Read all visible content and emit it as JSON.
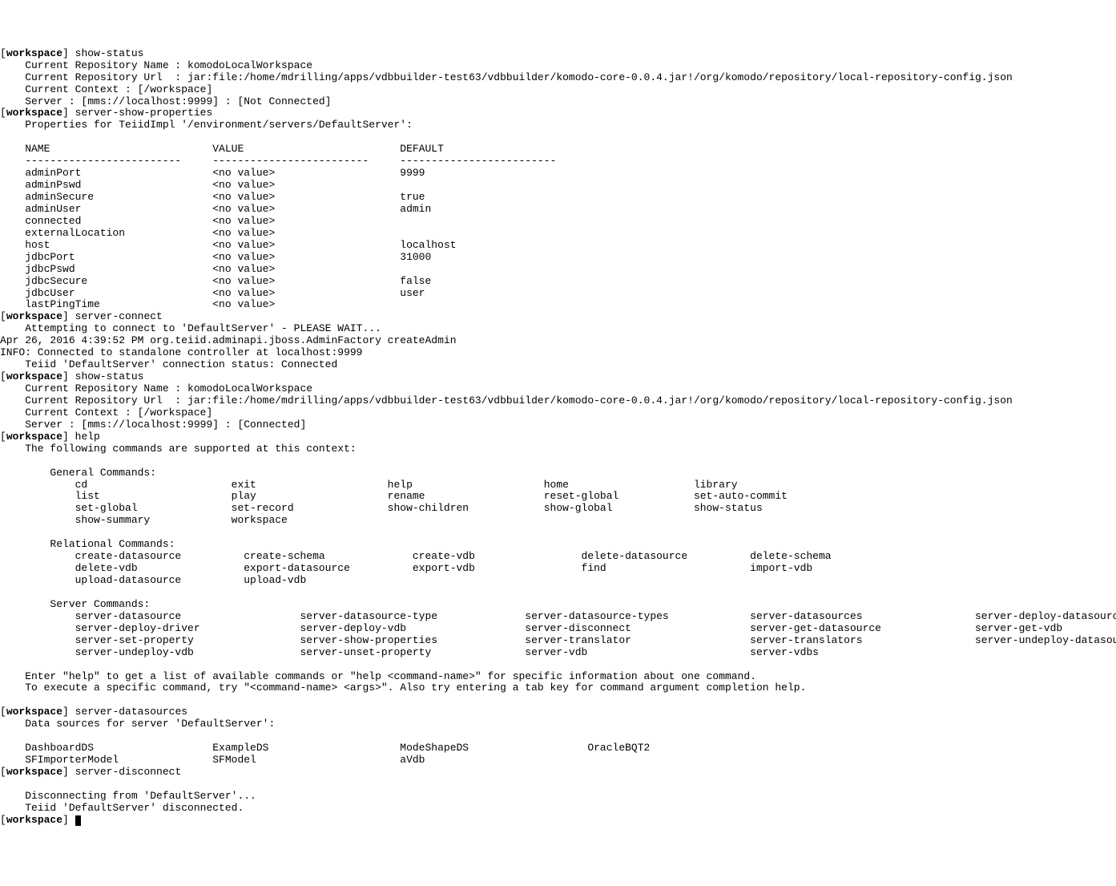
{
  "prompt_bold": "workspace",
  "commands": {
    "c1": "show-status",
    "c2": "server-show-properties",
    "c3": "server-connect",
    "c4": "show-status",
    "c5": "help",
    "c6": "server-datasources",
    "c7": "server-disconnect",
    "c8": ""
  },
  "status1": {
    "repo_name": "    Current Repository Name : komodoLocalWorkspace",
    "repo_url": "    Current Repository Url  : jar:file:/home/mdrilling/apps/vdbbuilder-test63/vdbbuilder/komodo-core-0.0.4.jar!/org/komodo/repository/local-repository-config.json",
    "context": "    Current Context : [/workspace]",
    "server": "    Server : [mms://localhost:9999] : [Not Connected]"
  },
  "server_props": {
    "header": "    Properties for TeiidImpl '/environment/servers/DefaultServer':",
    "blank": "",
    "cols": "    NAME                          VALUE                         DEFAULT",
    "sep": "    -------------------------     -------------------------     -------------------------",
    "r1": "    adminPort                     <no value>                    9999",
    "r2": "    adminPswd                     <no value>",
    "r3": "    adminSecure                   <no value>                    true",
    "r4": "    adminUser                     <no value>                    admin",
    "r5": "    connected                     <no value>",
    "r6": "    externalLocation              <no value>",
    "r7": "    host                          <no value>                    localhost",
    "r8": "    jdbcPort                      <no value>                    31000",
    "r9": "    jdbcPswd                      <no value>",
    "r10": "    jdbcSecure                    <no value>                    false",
    "r11": "    jdbcUser                      <no value>                    user",
    "r12": "    lastPingTime                  <no value>"
  },
  "connect": {
    "l1": "    Attempting to connect to 'DefaultServer' - PLEASE WAIT...",
    "l2": "Apr 26, 2016 4:39:52 PM org.teiid.adminapi.jboss.AdminFactory createAdmin",
    "l3": "INFO: Connected to standalone controller at localhost:9999",
    "l4": "    Teiid 'DefaultServer' connection status: Connected"
  },
  "status2": {
    "repo_name": "    Current Repository Name : komodoLocalWorkspace",
    "repo_url": "    Current Repository Url  : jar:file:/home/mdrilling/apps/vdbbuilder-test63/vdbbuilder/komodo-core-0.0.4.jar!/org/komodo/repository/local-repository-config.json",
    "context": "    Current Context : [/workspace]",
    "server": "    Server : [mms://localhost:9999] : [Connected]"
  },
  "help": {
    "intro": "    The following commands are supported at this context:",
    "blank": "",
    "gen_title": "        General Commands:",
    "gen_r1": "            cd                       exit                     help                     home                    library",
    "gen_r2": "            list                     play                     rename                   reset-global            set-auto-commit",
    "gen_r3": "            set-global               set-record               show-children            show-global             show-status",
    "gen_r4": "            show-summary             workspace",
    "rel_title": "        Relational Commands:",
    "rel_r1": "            create-datasource          create-schema              create-vdb                 delete-datasource          delete-schema",
    "rel_r2": "            delete-vdb                 export-datasource          export-vdb                 find                       import-vdb",
    "rel_r3": "            upload-datasource          upload-vdb",
    "srv_title": "        Server Commands:",
    "srv_r1": "            server-datasource                   server-datasource-type              server-datasource-types             server-datasources                  server-deploy-datasource",
    "srv_r2": "            server-deploy-driver                server-deploy-vdb                   server-disconnect                   server-get-datasource               server-get-vdb",
    "srv_r3": "            server-set-property                 server-show-properties              server-translator                   server-translators                  server-undeploy-datasource",
    "srv_r4": "            server-undeploy-vdb                 server-unset-property               server-vdb                          server-vdbs",
    "foot1": "    Enter \"help\" to get a list of available commands or \"help <command-name>\" for specific information about one command.",
    "foot2": "    To execute a specific command, try \"<command-name> <args>\". Also try entering a tab key for command argument completion help."
  },
  "datasources": {
    "header": "    Data sources for server 'DefaultServer':",
    "blank": "",
    "r1": "    DashboardDS                   ExampleDS                     ModeShapeDS                   OracleBQT2",
    "r2": "    SFImporterModel               SFModel                       aVdb"
  },
  "disconnect": {
    "blank": "",
    "l1": "    Disconnecting from 'DefaultServer'...",
    "l2": "    Teiid 'DefaultServer' disconnected."
  }
}
